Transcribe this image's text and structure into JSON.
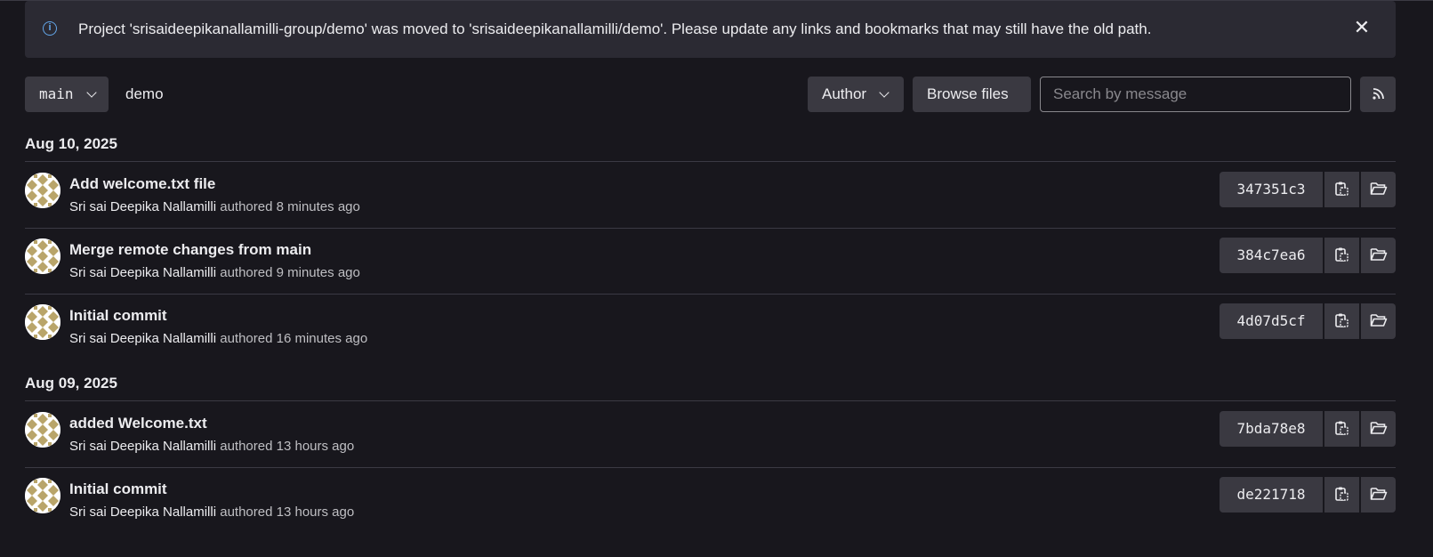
{
  "alert": {
    "message": "Project 'srisaideepikanallamilli-group/demo' was moved to 'srisaideepikanallamilli/demo'. Please update any links and bookmarks that may still have the old path.",
    "icon": "info-icon",
    "close_icon": "close-icon"
  },
  "toolbar": {
    "branch": "main",
    "breadcrumb": "demo",
    "author_label": "Author",
    "browse_label": "Browse files",
    "search_placeholder": "Search by message",
    "rss_icon": "rss-icon"
  },
  "groups": [
    {
      "date": "Aug 10, 2025",
      "commits": [
        {
          "title": "Add welcome.txt file",
          "author": "Sri sai Deepika Nallamilli",
          "time": "authored 8 minutes ago",
          "sha": "347351c3"
        },
        {
          "title": "Merge remote changes from main",
          "author": "Sri sai Deepika Nallamilli",
          "time": "authored 9 minutes ago",
          "sha": "384c7ea6"
        },
        {
          "title": "Initial commit",
          "author": "Sri sai Deepika Nallamilli",
          "time": "authored 16 minutes ago",
          "sha": "4d07d5cf"
        }
      ]
    },
    {
      "date": "Aug 09, 2025",
      "commits": [
        {
          "title": "added Welcome.txt",
          "author": "Sri sai Deepika Nallamilli",
          "time": "authored 13 hours ago",
          "sha": "7bda78e8"
        },
        {
          "title": "Initial commit",
          "author": "Sri sai Deepika Nallamilli",
          "time": "authored 13 hours ago",
          "sha": "de221718"
        }
      ]
    }
  ],
  "colors": {
    "background": "#18171d",
    "button": "#3a3941",
    "accent": "#63a6e9",
    "avatar_gold": "#b9a56a"
  }
}
